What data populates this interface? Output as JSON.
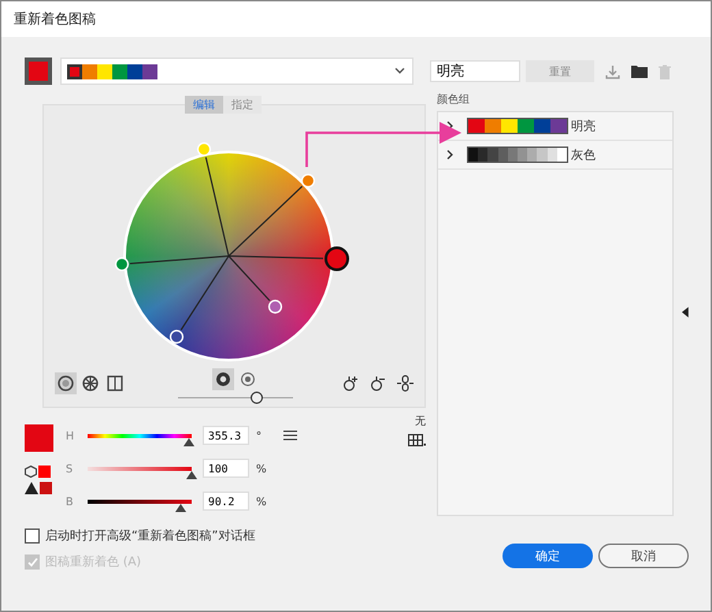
{
  "window": {
    "title": "重新着色图稿"
  },
  "toolbar": {
    "harmony_colors": [
      {
        "color": "#e30613"
      },
      {
        "color": "#ef7d00"
      },
      {
        "color": "#ffe600"
      },
      {
        "color": "#009640"
      },
      {
        "color": "#003f98"
      },
      {
        "color": "#6c3a96"
      }
    ],
    "group_name": "明亮",
    "reset_button": {
      "label": "重置",
      "disabled": true
    }
  },
  "editor": {
    "tabs": [
      {
        "label": "编辑",
        "selected": true
      },
      {
        "label": "指定",
        "selected": false
      }
    ],
    "handles": [
      {
        "color": "#ffe600",
        "selected": false
      },
      {
        "color": "#ef7d00",
        "selected": false
      },
      {
        "color": "#009640",
        "selected": false
      },
      {
        "color": "#e30613",
        "selected": true
      },
      {
        "color": "#b05fb0",
        "selected": false
      },
      {
        "color": "#3a4aa0",
        "selected": false
      }
    ],
    "view_modes": [
      {
        "kind": "smooth",
        "selected": true
      },
      {
        "kind": "segmented",
        "selected": false
      },
      {
        "kind": "bars",
        "selected": false
      }
    ],
    "display_modes": [
      {
        "kind": "brightness",
        "selected": true
      },
      {
        "kind": "saturation",
        "selected": false
      }
    ],
    "level": 0.68
  },
  "color": {
    "sliders": [
      {
        "label": "H",
        "kind": "hue",
        "value": "355.3",
        "unit": "°",
        "level": 0.98
      },
      {
        "label": "S",
        "kind": "saturation",
        "value": "100",
        "unit": "%",
        "level": 1
      },
      {
        "label": "B",
        "kind": "brightness",
        "value": "90.2",
        "unit": "%",
        "level": 0.9
      }
    ],
    "none_label": "无"
  },
  "color_groups": {
    "label": "颜色组",
    "groups": [
      {
        "name": "明亮",
        "colors": [
          {
            "color": "#e30613"
          },
          {
            "color": "#ef7d00"
          },
          {
            "color": "#ffe600"
          },
          {
            "color": "#009640"
          },
          {
            "color": "#003f98"
          },
          {
            "color": "#6c3a96"
          }
        ]
      },
      {
        "name": "灰色",
        "colors": [
          {
            "color": "#111111"
          },
          {
            "color": "#2a2a2a"
          },
          {
            "color": "#444444"
          },
          {
            "color": "#5e5e5e"
          },
          {
            "color": "#787878"
          },
          {
            "color": "#929292"
          },
          {
            "color": "#acacac"
          },
          {
            "color": "#c6c6c6"
          },
          {
            "color": "#e0e0e0"
          },
          {
            "color": "#ffffff"
          }
        ]
      }
    ]
  },
  "options": [
    {
      "label": "启动时打开高级“重新着色图稿”对话框",
      "checked": false,
      "disabled": false
    },
    {
      "label": "图稿重新着色 (A)",
      "checked": true,
      "disabled": true
    }
  ],
  "buttons": [
    {
      "label": "确定",
      "kind": "primary"
    },
    {
      "label": "取消",
      "kind": "secondary"
    }
  ]
}
